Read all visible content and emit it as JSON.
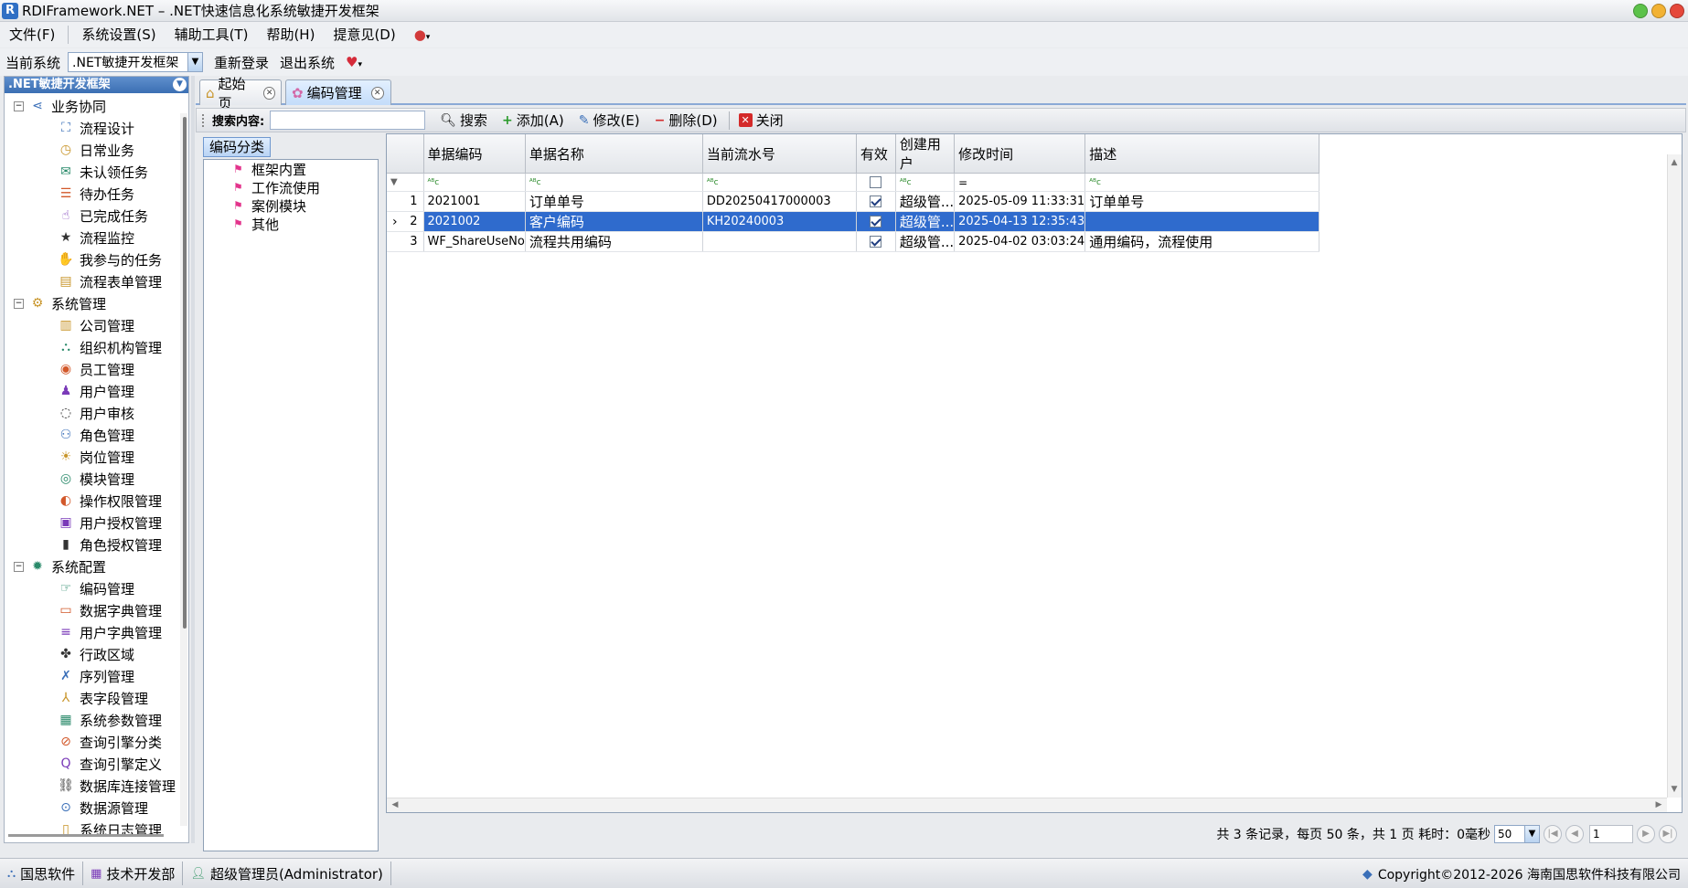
{
  "window": {
    "title": "RDIFramework.NET – .NET快速信息化系统敏捷开发框架",
    "logo": "R"
  },
  "menu": {
    "items": [
      "文件(F)",
      "系统设置(S)",
      "辅助工具(T)",
      "帮助(H)",
      "提意见(D)"
    ]
  },
  "sysbar": {
    "label": "当前系统",
    "selected": ".NET敏捷开发框架",
    "relogin": "重新登录",
    "logout": "退出系统"
  },
  "leftpanel": {
    "title": ".NET敏捷开发框架",
    "groups": [
      {
        "label": "业务协同",
        "icon": "share-icon",
        "items": [
          {
            "label": "流程设计",
            "icon": "flow-design-icon"
          },
          {
            "label": "日常业务",
            "icon": "clock-icon"
          },
          {
            "label": "未认领任务",
            "icon": "unclaimed-task-icon"
          },
          {
            "label": "待办任务",
            "icon": "todo-task-icon"
          },
          {
            "label": "已完成任务",
            "icon": "hand-icon"
          },
          {
            "label": "流程监控",
            "icon": "star-icon"
          },
          {
            "label": "我参与的任务",
            "icon": "participate-icon"
          },
          {
            "label": "流程表单管理",
            "icon": "form-icon"
          }
        ]
      },
      {
        "label": "系统管理",
        "icon": "gears-icon",
        "items": [
          {
            "label": "公司管理",
            "icon": "company-icon"
          },
          {
            "label": "组织机构管理",
            "icon": "org-chart-icon"
          },
          {
            "label": "员工管理",
            "icon": "employee-icon"
          },
          {
            "label": "用户管理",
            "icon": "user-icon"
          },
          {
            "label": "用户审核",
            "icon": "audit-icon"
          },
          {
            "label": "角色管理",
            "icon": "role-icon"
          },
          {
            "label": "岗位管理",
            "icon": "bulb-icon"
          },
          {
            "label": "模块管理",
            "icon": "module-icon"
          },
          {
            "label": "操作权限管理",
            "icon": "shield-icon"
          },
          {
            "label": "用户授权管理",
            "icon": "user-auth-icon"
          },
          {
            "label": "角色授权管理",
            "icon": "role-auth-icon"
          }
        ]
      },
      {
        "label": "系统配置",
        "icon": "config-icon",
        "items": [
          {
            "label": "编码管理",
            "icon": "coding-icon"
          },
          {
            "label": "数据字典管理",
            "icon": "dictionary-icon"
          },
          {
            "label": "用户字典管理",
            "icon": "list-icon"
          },
          {
            "label": "行政区域",
            "icon": "region-icon"
          },
          {
            "label": "序列管理",
            "icon": "sequence-icon"
          },
          {
            "label": "表字段管理",
            "icon": "field-icon"
          },
          {
            "label": "系统参数管理",
            "icon": "param-icon"
          },
          {
            "label": "查询引擎分类",
            "icon": "query-category-icon"
          },
          {
            "label": "查询引擎定义",
            "icon": "query-define-icon"
          },
          {
            "label": "数据库连接管理",
            "icon": "link-icon"
          },
          {
            "label": "数据源管理",
            "icon": "datasource-icon"
          },
          {
            "label": "系统日志管理",
            "icon": "log-icon"
          }
        ]
      }
    ]
  },
  "tabs": [
    {
      "label": "起始页",
      "icon": "home-icon",
      "active": false
    },
    {
      "label": "编码管理",
      "icon": "coding-icon",
      "active": true
    }
  ],
  "toolbar": {
    "search_label": "搜索内容:",
    "search_value": "",
    "search": "搜索",
    "add": "添加(A)",
    "edit": "修改(E)",
    "delete": "删除(D)",
    "close": "关闭"
  },
  "category": {
    "title": "编码分类",
    "items": [
      "框架内置",
      "工作流使用",
      "案例模块",
      "其他"
    ]
  },
  "grid": {
    "columns": [
      "单据编码",
      "单据名称",
      "当前流水号",
      "有效",
      "创建用户",
      "修改时间",
      "描述"
    ],
    "filter_eq": "=",
    "rows": [
      {
        "num": "1",
        "code": "2021001",
        "name": "订单单号",
        "serial": "DD20250417000003",
        "valid": true,
        "creator": "超级管...",
        "modified": "2025-05-09 11:33:31",
        "desc": "订单单号",
        "selected": false
      },
      {
        "num": "2",
        "code": "2021002",
        "name": "客户编码",
        "serial": "KH20240003",
        "valid": true,
        "creator": "超级管...",
        "modified": "2025-04-13 12:35:43",
        "desc": "",
        "selected": true
      },
      {
        "num": "3",
        "code": "WF_ShareUseNo",
        "name": "流程共用编码",
        "serial": "",
        "valid": true,
        "creator": "超级管...",
        "modified": "2025-04-02 03:03:24",
        "desc": "通用编码，流程使用",
        "selected": false
      }
    ]
  },
  "pager": {
    "summary": "共 3 条记录，每页 50 条，共 1 页 耗时：0毫秒",
    "page_size": "50",
    "page": "1"
  },
  "status": {
    "company": "国思软件",
    "department": "技术开发部",
    "user": "超级管理员(Administrator)",
    "copyright": "Copyright©2012-2026 海南国思软件科技有限公司"
  },
  "colors": {
    "selection": "#2f6bcd",
    "header_blue": "#3b6fb3",
    "tab_active": "#c3dcfa"
  }
}
